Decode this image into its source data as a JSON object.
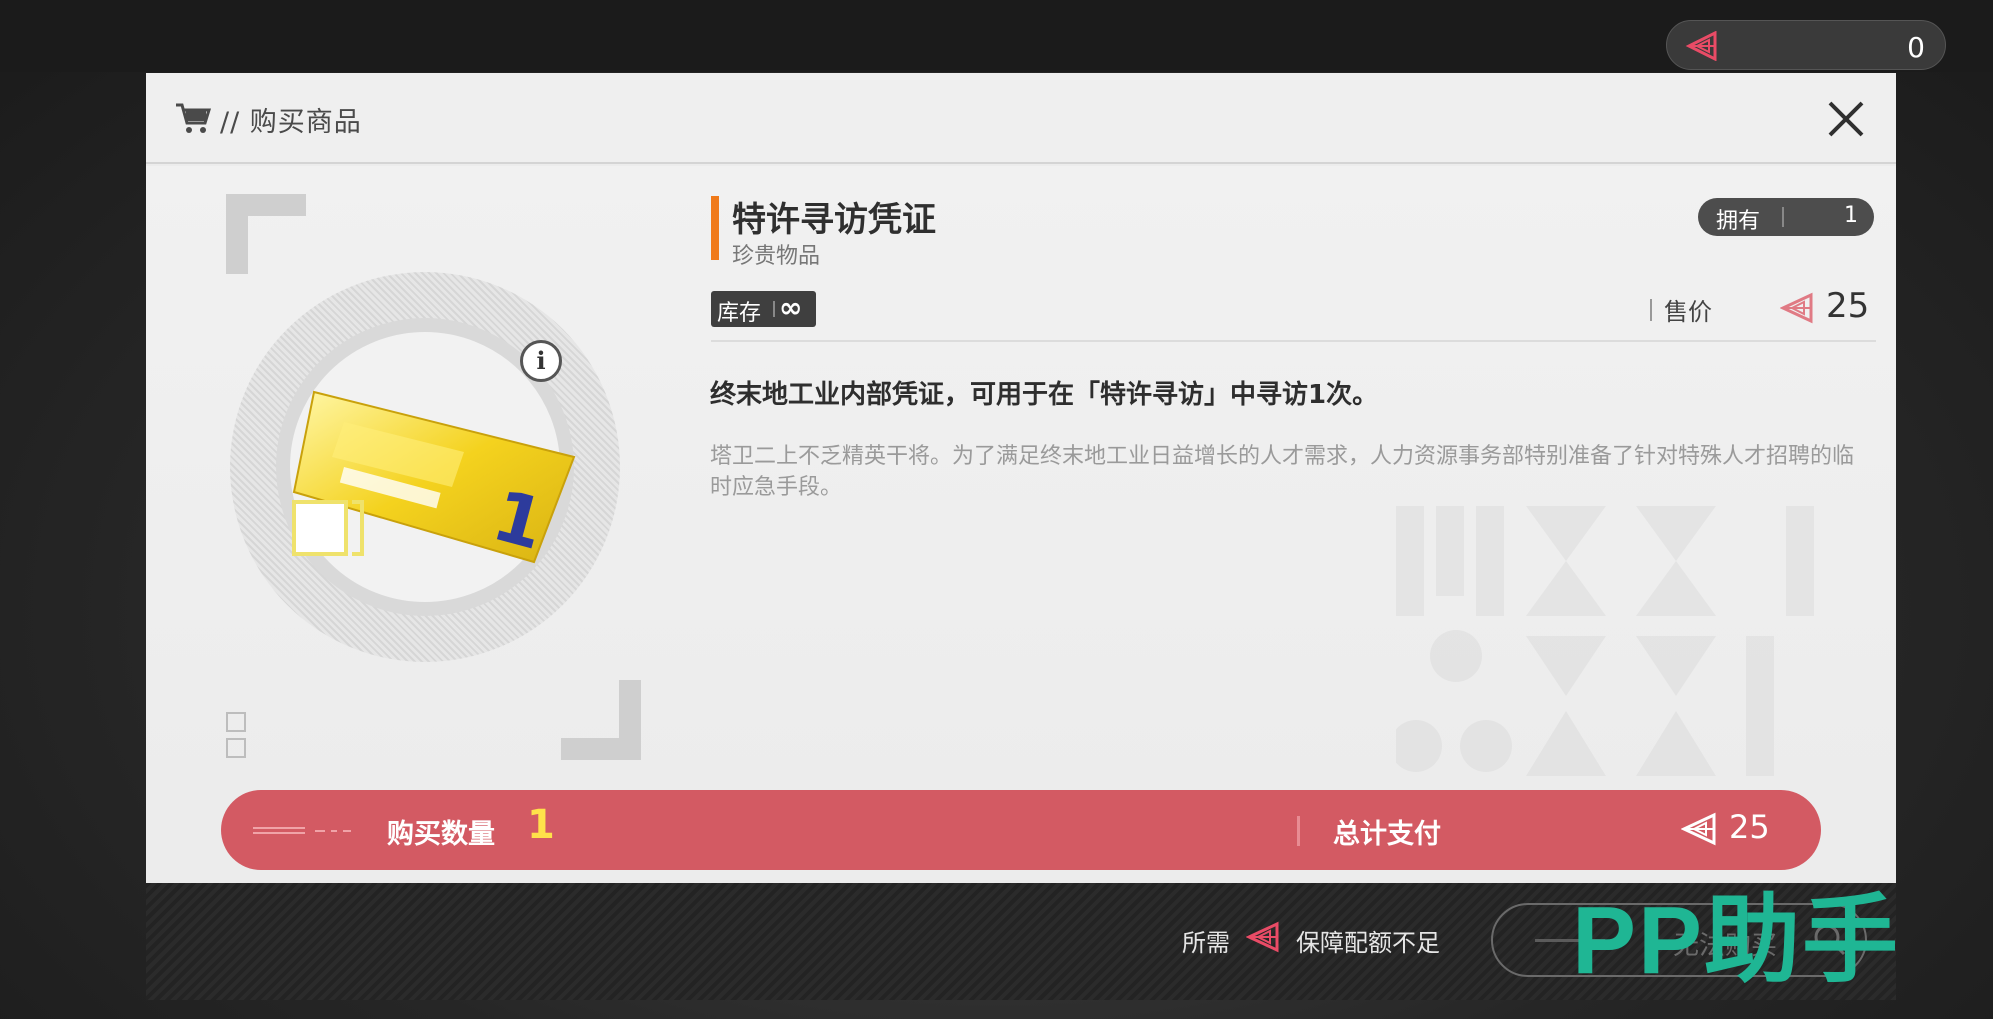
{
  "top_currency": {
    "icon": "quota-icon",
    "value": "0"
  },
  "dialog": {
    "title": "// 购买商品",
    "icons": {
      "cart": "cart-icon",
      "close": "close-icon"
    }
  },
  "item": {
    "name": "特许寻访凭证",
    "category": "珍贵物品",
    "owned_label": "拥有",
    "owned_count": "1",
    "stock_label": "库存",
    "stock_value": "∞",
    "price_label": "售价",
    "price_value": "25",
    "description": "终末地工业内部凭证，可用于在「特许寻访」中寻访1次。",
    "flavor_text": "塔卫二上不乏精英干将。为了满足终末地工业日益增长的人才需求，人力资源事务部特别准备了针对特殊人才招聘的临时应急手段。",
    "info_symbol": "i",
    "ticket_number": "1"
  },
  "purchase": {
    "quantity_label": "购买数量",
    "quantity": "1",
    "total_label": "总计支付",
    "total": "25"
  },
  "footer": {
    "need_label": "所需",
    "insufficient_msg": "保障配额不足",
    "buy_button_label": "无法购买"
  },
  "watermark": "PP助手",
  "colors": {
    "accent": "#f07a1a",
    "purchase_bar": "#d35a63",
    "quantity_highlight": "#ffe14a",
    "watermark": "#1fb694"
  }
}
